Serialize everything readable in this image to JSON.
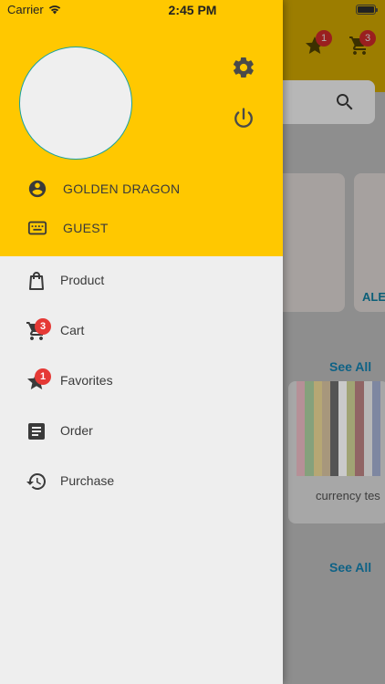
{
  "status_bar": {
    "carrier": "Carrier",
    "time": "2:45 PM"
  },
  "background": {
    "app_bar": {
      "favorites_badge": "1",
      "cart_badge": "3"
    },
    "brand_label": "ALE",
    "see_all_1": "See All",
    "see_all_2": "See All",
    "product_label": "currency tes",
    "stripe_colors": [
      "#a8a8a8",
      "#c27e8a",
      "#6a9d5a",
      "#c2a74a",
      "#a88b5a",
      "#111111",
      "#e8e8e8",
      "#9da24a",
      "#7f2f2f",
      "#c7c7c7",
      "#5c6d9c",
      "#a8a8a8"
    ]
  },
  "drawer": {
    "header": {
      "user_name": "GOLDEN DRAGON",
      "user_role": "GUEST",
      "settings_icon": "gear-icon",
      "logout_icon": "power-icon"
    },
    "menu": [
      {
        "label": "Product",
        "icon": "shopping-bag-icon"
      },
      {
        "label": "Cart",
        "icon": "cart-icon",
        "badge": "3"
      },
      {
        "label": "Favorites",
        "icon": "star-icon",
        "badge": "1"
      },
      {
        "label": "Order",
        "icon": "receipt-icon"
      },
      {
        "label": "Purchase",
        "icon": "history-icon"
      }
    ]
  },
  "colors": {
    "drawer_header": "#ffc800",
    "badge": "#e53935",
    "link": "#0e6286"
  }
}
